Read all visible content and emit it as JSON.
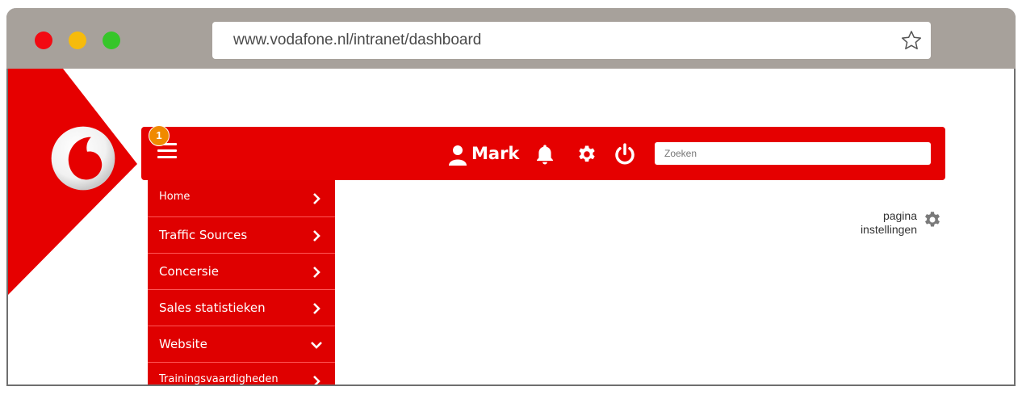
{
  "browser": {
    "url": "www.vodafone.nl/intranet/dashboard",
    "bookmark_icon": "star-icon"
  },
  "colors": {
    "brand_red": "#e50000",
    "badge": "#f08a00",
    "titlebar": "#a7a19b"
  },
  "header": {
    "menu_icon": "hamburger-icon",
    "badge_count": "1",
    "user_name": "Mark",
    "search_placeholder": "Zoeken",
    "icons": [
      "user-icon",
      "bell-icon",
      "gear-icon",
      "power-icon"
    ]
  },
  "menu": {
    "items": [
      {
        "label": "Home",
        "icon": "chevron-right-icon"
      },
      {
        "label": "Traffic Sources",
        "icon": "chevron-right-icon"
      },
      {
        "label": "Concersie",
        "icon": "chevron-right-icon"
      },
      {
        "label": "Sales statistieken",
        "icon": "chevron-right-icon"
      },
      {
        "label": "Website",
        "icon": "chevron-down-icon"
      },
      {
        "label": "Trainingsvaardigheden",
        "icon": "chevron-right-icon"
      }
    ]
  },
  "page_settings": {
    "line1": "pagina",
    "line2": "instellingen",
    "icon": "gear-icon"
  }
}
